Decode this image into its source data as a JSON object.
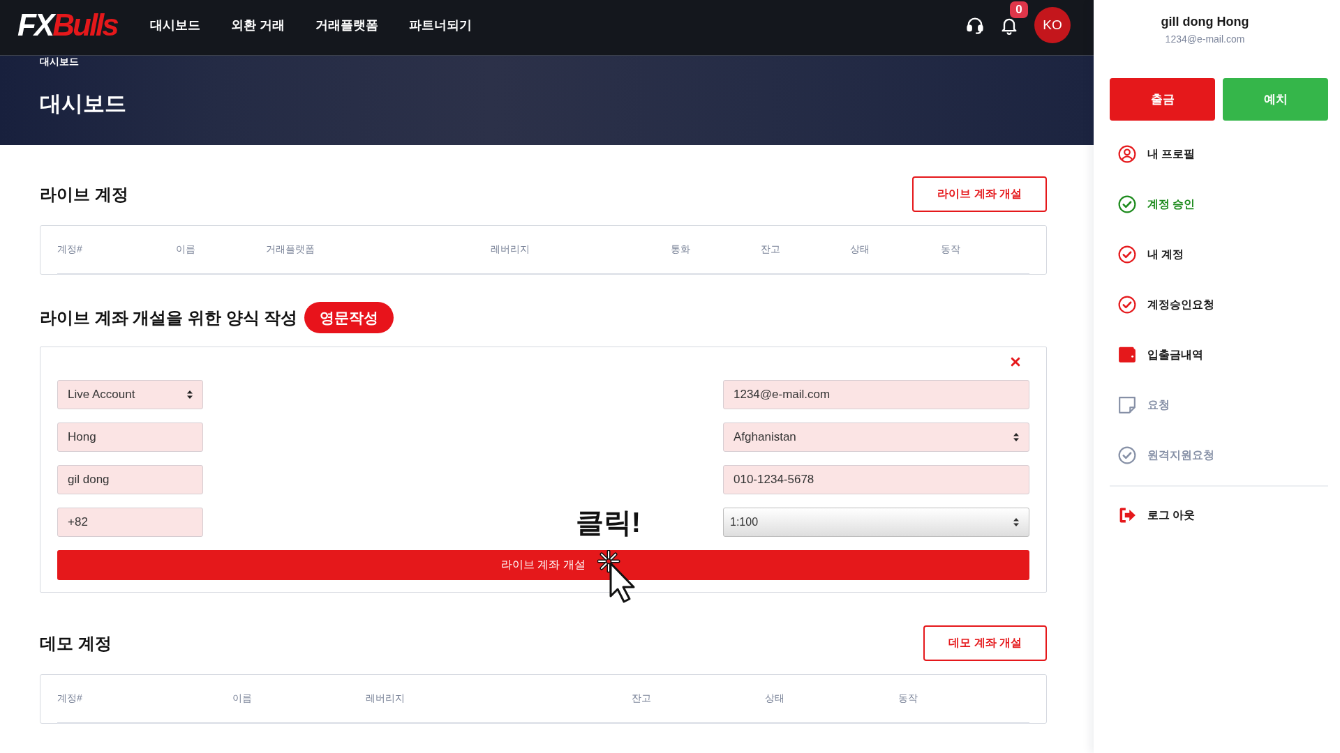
{
  "header": {
    "logo": {
      "part1": "FX",
      "part2": "Bulls"
    },
    "nav": [
      "대시보드",
      "외환 거래",
      "거래플랫폼",
      "파트너되기"
    ],
    "notification_count": "0",
    "language": "KO"
  },
  "banner": {
    "breadcrumb": "대시보드",
    "title": "대시보드"
  },
  "live_accounts": {
    "title": "라이브 계정",
    "button": "라이브 계좌 개설",
    "columns": [
      "계정#",
      "이름",
      "거래플랫폼",
      "레버리지",
      "통화",
      "잔고",
      "상태",
      "동작"
    ]
  },
  "form": {
    "title": "라이브 계좌 개설을 위한 양식 작성",
    "badge": "영문작성",
    "left_fields": [
      {
        "kind": "select",
        "value": "Live Account"
      },
      {
        "kind": "input",
        "value": "Hong"
      },
      {
        "kind": "input",
        "value": "gil dong"
      },
      {
        "kind": "input",
        "value": "+82"
      }
    ],
    "right_fields": [
      {
        "kind": "input",
        "value": "1234@e-mail.com"
      },
      {
        "kind": "select",
        "value": "Afghanistan"
      },
      {
        "kind": "input",
        "value": "010-1234-5678"
      },
      {
        "kind": "native_select",
        "value": "1:100"
      }
    ],
    "hint": "클릭!",
    "submit": "라이브 계좌 개설"
  },
  "demo_accounts": {
    "title": "데모 계정",
    "button": "데모 계좌 개설",
    "columns": [
      "계정#",
      "이름",
      "레버리지",
      "잔고",
      "상태",
      "동작"
    ]
  },
  "sidebar": {
    "user_name": "gill dong Hong",
    "email": "1234@e-mail.com",
    "buttons": [
      {
        "kind": "withdraw",
        "label": "출금"
      },
      {
        "kind": "deposit",
        "label": "예치"
      }
    ],
    "menu": [
      {
        "kind": "user",
        "approved": false,
        "disabled": false,
        "label": "내 프로필"
      },
      {
        "kind": "check",
        "approved": true,
        "disabled": false,
        "label": "계정 승인"
      },
      {
        "kind": "check",
        "approved": false,
        "disabled": false,
        "label": "내 계정"
      },
      {
        "kind": "check",
        "approved": false,
        "disabled": false,
        "label": "계정승인요청"
      },
      {
        "kind": "wallet",
        "approved": false,
        "disabled": false,
        "label": "입출금내역"
      },
      {
        "kind": "note",
        "approved": false,
        "disabled": true,
        "label": "요청"
      },
      {
        "kind": "check",
        "approved": false,
        "disabled": true,
        "label": "원격지원요청"
      }
    ],
    "footer_menu": [
      {
        "kind": "logout",
        "label": "로그 아웃"
      }
    ]
  }
}
